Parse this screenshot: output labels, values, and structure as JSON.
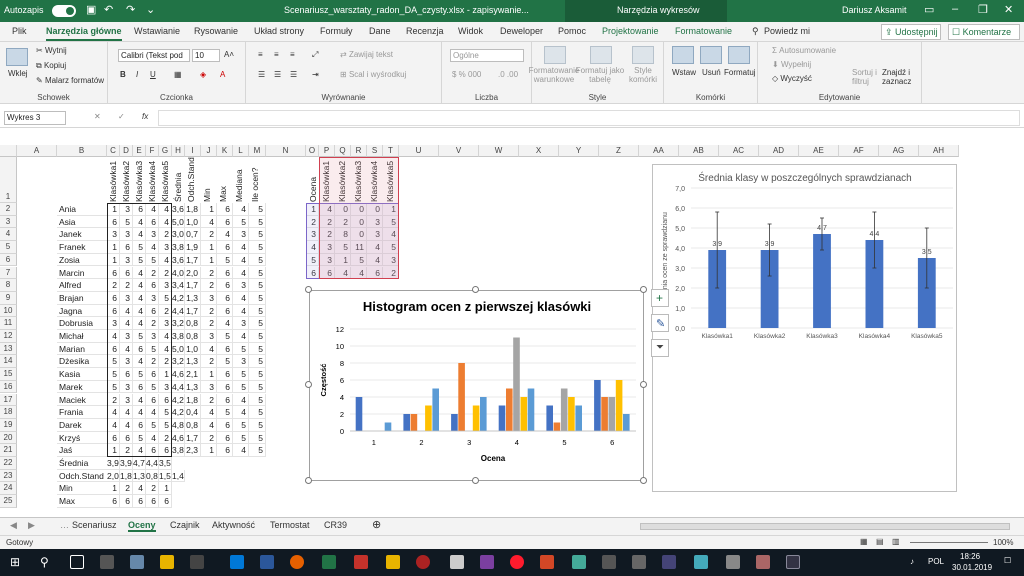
{
  "titlebar": {
    "autosave": "Autozapis",
    "filename": "Scenariusz_warsztaty_radon_DA_czysty.xlsx - zapisywanie...",
    "context": "Narzędzia wykresów",
    "user": "Dariusz Aksamit"
  },
  "menu": {
    "tabs": [
      "Plik",
      "Narzędzia główne",
      "Wstawianie",
      "Rysowanie",
      "Układ strony",
      "Formuły",
      "Dane",
      "Recenzja",
      "Widok",
      "Deweloper",
      "Pomoc",
      "Projektowanie",
      "Formatowanie"
    ],
    "tell": "Powiedz mi",
    "share": "Udostępnij",
    "comments": "Komentarze"
  },
  "ribbon": {
    "paste": "Wklej",
    "cut": "Wytnij",
    "copy": "Kopiuj",
    "painter": "Malarz formatów",
    "clipboard": "Schowek",
    "font_name": "Calibri (Tekst pod",
    "font_size": "10",
    "font": "Czcionka",
    "wrap": "Zawijaj tekst",
    "merge": "Scal i wyśrodkuj",
    "alignment": "Wyrównanie",
    "numfmt": "Ogólne",
    "number": "Liczba",
    "cond": "Formatowanie warunkowe",
    "astable": "Formatuj jako tabelę",
    "cellstyles": "Style komórki",
    "styles": "Style",
    "insert": "Wstaw",
    "delete": "Usuń",
    "format": "Formatuj",
    "cells": "Komórki",
    "autosum": "Autosumowanie",
    "fill": "Wypełnij",
    "clear": "Wyczyść",
    "sort": "Sortuj i filtruj",
    "find": "Znajdź i zaznacz",
    "editing": "Edytowanie"
  },
  "formula": {
    "namebox": "Wykres 3",
    "value": "",
    "fx": "fx"
  },
  "columns": [
    "A",
    "B",
    "C",
    "D",
    "E",
    "F",
    "G",
    "H",
    "I",
    "J",
    "K",
    "L",
    "M",
    "N",
    "O",
    "P",
    "Q",
    "R",
    "S",
    "T",
    "U",
    "V",
    "W",
    "X",
    "Y",
    "Z",
    "AA",
    "AB",
    "AC",
    "AD",
    "AE",
    "AF",
    "AG",
    "AH"
  ],
  "headers_left": [
    "Klasówka1",
    "Klasówka2",
    "Klasówka3",
    "Klasówka4",
    "Klasówka5",
    "Średnia",
    "Odch.Stand",
    "Min",
    "Max",
    "Mediana",
    "Ile ocen?"
  ],
  "headers_right": [
    "Ocena",
    "Klasówka1",
    "Klasówka2",
    "Klasówka3",
    "Klasówka4",
    "Klasówka5"
  ],
  "students": [
    {
      "name": "Ania",
      "v": [
        "1",
        "3",
        "6",
        "4",
        "4",
        "3,6",
        "1,8",
        "1",
        "6",
        "4",
        "5"
      ]
    },
    {
      "name": "Asia",
      "v": [
        "6",
        "5",
        "4",
        "6",
        "4",
        "5,0",
        "1,0",
        "4",
        "6",
        "5",
        "5"
      ]
    },
    {
      "name": "Janek",
      "v": [
        "3",
        "3",
        "4",
        "3",
        "2",
        "3,0",
        "0,7",
        "2",
        "4",
        "3",
        "5"
      ]
    },
    {
      "name": "Franek",
      "v": [
        "1",
        "6",
        "5",
        "4",
        "3",
        "3,8",
        "1,9",
        "1",
        "6",
        "4",
        "5"
      ]
    },
    {
      "name": "Zosia",
      "v": [
        "1",
        "3",
        "5",
        "5",
        "4",
        "3,6",
        "1,7",
        "1",
        "5",
        "4",
        "5"
      ]
    },
    {
      "name": "Marcin",
      "v": [
        "6",
        "6",
        "4",
        "2",
        "2",
        "4,0",
        "2,0",
        "2",
        "6",
        "4",
        "5"
      ]
    },
    {
      "name": "Alfred",
      "v": [
        "2",
        "2",
        "4",
        "6",
        "3",
        "3,4",
        "1,7",
        "2",
        "6",
        "3",
        "5"
      ]
    },
    {
      "name": "Brajan",
      "v": [
        "6",
        "3",
        "4",
        "3",
        "5",
        "4,2",
        "1,3",
        "3",
        "6",
        "4",
        "5"
      ]
    },
    {
      "name": "Jagna",
      "v": [
        "6",
        "4",
        "4",
        "6",
        "2",
        "4,4",
        "1,7",
        "2",
        "6",
        "4",
        "5"
      ]
    },
    {
      "name": "Dobrusia",
      "v": [
        "3",
        "4",
        "4",
        "2",
        "3",
        "3,2",
        "0,8",
        "2",
        "4",
        "3",
        "5"
      ]
    },
    {
      "name": "Michał",
      "v": [
        "4",
        "3",
        "5",
        "3",
        "4",
        "3,8",
        "0,8",
        "3",
        "5",
        "4",
        "5"
      ]
    },
    {
      "name": "Marian",
      "v": [
        "6",
        "4",
        "6",
        "5",
        "4",
        "5,0",
        "1,0",
        "4",
        "6",
        "5",
        "5"
      ]
    },
    {
      "name": "Dżesika",
      "v": [
        "5",
        "3",
        "4",
        "2",
        "2",
        "3,2",
        "1,3",
        "2",
        "5",
        "3",
        "5"
      ]
    },
    {
      "name": "Kasia",
      "v": [
        "5",
        "6",
        "5",
        "6",
        "1",
        "4,6",
        "2,1",
        "1",
        "6",
        "5",
        "5"
      ]
    },
    {
      "name": "Marek",
      "v": [
        "5",
        "3",
        "6",
        "5",
        "3",
        "4,4",
        "1,3",
        "3",
        "6",
        "5",
        "5"
      ]
    },
    {
      "name": "Maciek",
      "v": [
        "2",
        "3",
        "4",
        "6",
        "6",
        "4,2",
        "1,8",
        "2",
        "6",
        "4",
        "5"
      ]
    },
    {
      "name": "Frania",
      "v": [
        "4",
        "4",
        "4",
        "4",
        "5",
        "4,2",
        "0,4",
        "4",
        "5",
        "4",
        "5"
      ]
    },
    {
      "name": "Darek",
      "v": [
        "4",
        "4",
        "6",
        "5",
        "5",
        "4,8",
        "0,8",
        "4",
        "6",
        "5",
        "5"
      ]
    },
    {
      "name": "Krzyś",
      "v": [
        "6",
        "6",
        "5",
        "4",
        "2",
        "4,6",
        "1,7",
        "2",
        "6",
        "5",
        "5"
      ]
    },
    {
      "name": "Jaś",
      "v": [
        "1",
        "2",
        "4",
        "6",
        "6",
        "3,8",
        "2,3",
        "1",
        "6",
        "4",
        "5"
      ]
    }
  ],
  "summary": [
    {
      "name": "Średnia",
      "v": [
        "3,9",
        "3,9",
        "4,7",
        "4,4",
        "3,5"
      ]
    },
    {
      "name": "Odch.Stand",
      "v": [
        "2,0",
        "1,8",
        "1,3",
        "0,8",
        "1,5",
        "1,4"
      ]
    },
    {
      "name": "Min",
      "v": [
        "1",
        "2",
        "4",
        "2",
        "1"
      ]
    },
    {
      "name": "Max",
      "v": [
        "6",
        "6",
        "6",
        "6",
        "6"
      ]
    }
  ],
  "freq": [
    [
      "1",
      "4",
      "0",
      "0",
      "0",
      "1"
    ],
    [
      "2",
      "2",
      "2",
      "0",
      "3",
      "5"
    ],
    [
      "3",
      "2",
      "8",
      "0",
      "3",
      "4"
    ],
    [
      "4",
      "3",
      "5",
      "11",
      "4",
      "5"
    ],
    [
      "5",
      "3",
      "1",
      "5",
      "4",
      "3"
    ],
    [
      "6",
      "6",
      "4",
      "4",
      "6",
      "2"
    ]
  ],
  "chart_data": [
    {
      "type": "bar",
      "title": "Histogram ocen z pierwszej klasówki",
      "xlabel": "Ocena",
      "ylabel": "Częstość",
      "categories": [
        "1",
        "2",
        "3",
        "4",
        "5",
        "6"
      ],
      "ylim": [
        0,
        12
      ],
      "yticks": [
        "0",
        "2",
        "4",
        "6",
        "8",
        "10",
        "12"
      ],
      "series_colors": [
        "#4472c4",
        "#ed7d31",
        "#a5a5a5",
        "#ffc000",
        "#5b9bd5"
      ],
      "series": [
        {
          "values": [
            4,
            2,
            2,
            3,
            3,
            6
          ]
        },
        {
          "values": [
            0,
            2,
            8,
            5,
            1,
            4
          ]
        },
        {
          "values": [
            0,
            0,
            0,
            11,
            5,
            4
          ]
        },
        {
          "values": [
            0,
            3,
            3,
            4,
            4,
            6
          ]
        },
        {
          "values": [
            1,
            5,
            4,
            5,
            3,
            2
          ]
        }
      ]
    },
    {
      "type": "bar",
      "title": "Średnia klasy w poszczególnych sprawdzianach",
      "ylabel": "Średnia ocen ze sprawdzianu",
      "categories": [
        "Klasówka1",
        "Klasówka2",
        "Klasówka3",
        "Klasówka4",
        "Klasówka5"
      ],
      "values": [
        3.9,
        3.9,
        4.7,
        4.4,
        3.5
      ],
      "errors": [
        1.9,
        1.3,
        0.8,
        1.4,
        1.5
      ],
      "labels": [
        "3,9",
        "3,9",
        "4,7",
        "4,4",
        "3,5"
      ],
      "ylim": [
        0,
        7
      ],
      "yticks": [
        "0,0",
        "1,0",
        "2,0",
        "3,0",
        "4,0",
        "5,0",
        "6,0",
        "7,0"
      ],
      "color": "#4472c4"
    }
  ],
  "sheets": [
    "Scenariusz",
    "Oceny",
    "Czajnik",
    "Aktywność",
    "Termostat",
    "CR39"
  ],
  "status": {
    "left": "Gotowy",
    "zoom": "100%"
  },
  "taskbar": {
    "lang": "POL",
    "time": "18:26",
    "date": "30.01.2019"
  }
}
